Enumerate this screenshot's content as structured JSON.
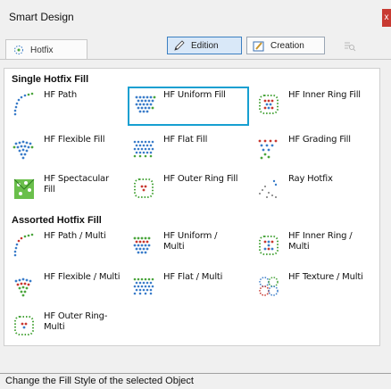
{
  "window": {
    "title": "Smart Design",
    "close_label": "x"
  },
  "tabs": {
    "hotfix_label": "Hotfix"
  },
  "toolbar": {
    "edition_label": "Edition",
    "creation_label": "Creation"
  },
  "sections": [
    {
      "title": "Single Hotfix Fill",
      "items": [
        {
          "label": "HF Path",
          "icon": "hf-path-icon"
        },
        {
          "label": "HF Uniform Fill",
          "icon": "hf-uniform-fill-icon",
          "selected": true
        },
        {
          "label": "HF Inner Ring Fill",
          "icon": "hf-inner-ring-fill-icon"
        },
        {
          "label": "HF Flexible Fill",
          "icon": "hf-flexible-fill-icon"
        },
        {
          "label": "HF Flat Fill",
          "icon": "hf-flat-fill-icon"
        },
        {
          "label": "HF Grading Fill",
          "icon": "hf-grading-fill-icon"
        },
        {
          "label": "HF Spectacular Fill",
          "icon": "hf-spectacular-fill-icon"
        },
        {
          "label": "HF Outer Ring Fill",
          "icon": "hf-outer-ring-fill-icon"
        },
        {
          "label": "Ray Hotfix",
          "icon": "ray-hotfix-icon"
        }
      ]
    },
    {
      "title": "Assorted Hotfix Fill",
      "items": [
        {
          "label": "HF Path / Multi",
          "icon": "hf-path-multi-icon"
        },
        {
          "label": "HF Uniform / Multi",
          "icon": "hf-uniform-multi-icon"
        },
        {
          "label": "HF Inner Ring / Multi",
          "icon": "hf-inner-ring-multi-icon"
        },
        {
          "label": "HF Flexible / Multi",
          "icon": "hf-flexible-multi-icon"
        },
        {
          "label": "HF Flat / Multi",
          "icon": "hf-flat-multi-icon"
        },
        {
          "label": "HF Texture / Multi",
          "icon": "hf-texture-multi-icon"
        },
        {
          "label": "HF Outer Ring-Multi",
          "icon": "hf-outer-ring-multi-icon"
        }
      ]
    }
  ],
  "status": {
    "text": "Change the Fill Style of the selected Object"
  },
  "colors": {
    "accent": "#169fd1",
    "dot_blue": "#3a7cc9",
    "dot_green": "#4aa53c",
    "dot_red": "#c8362e"
  }
}
